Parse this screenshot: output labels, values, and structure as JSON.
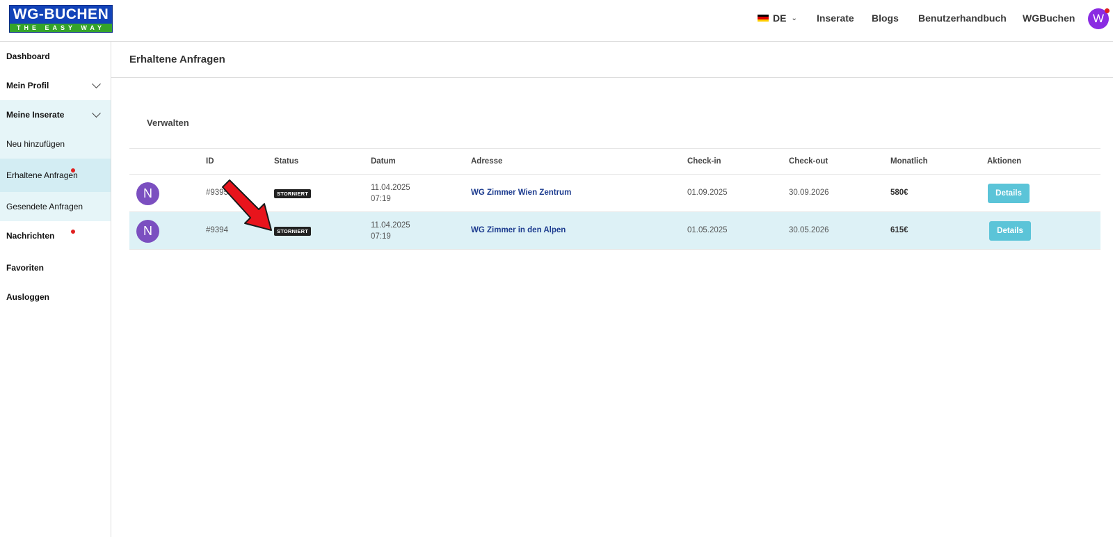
{
  "header": {
    "logo_main": "WG-BUCHEN",
    "logo_tagline": "THE EASY WAY",
    "language": "DE",
    "nav": [
      "Inserate",
      "Blogs",
      "Benutzerhandbuch",
      "WGBuchen"
    ],
    "user_initial": "W"
  },
  "sidebar": {
    "items": [
      {
        "label": "Dashboard"
      },
      {
        "label": "Mein Profil"
      },
      {
        "label": "Meine Inserate"
      },
      {
        "label": "Neu hinzufügen"
      },
      {
        "label": "Erhaltene Anfragen"
      },
      {
        "label": "Gesendete Anfragen"
      },
      {
        "label": "Nachrichten"
      },
      {
        "label": "Favoriten"
      },
      {
        "label": "Ausloggen"
      }
    ]
  },
  "main": {
    "page_title": "Erhaltene Anfragen",
    "section_title": "Verwalten",
    "columns": [
      "ID",
      "Status",
      "Datum",
      "Adresse",
      "Check-in",
      "Check-out",
      "Monatlich",
      "Aktionen"
    ],
    "rows": [
      {
        "initial": "N",
        "id": "#9395",
        "status": "STORNIERT",
        "date": "11.04.2025",
        "time": "07:19",
        "address": "WG Zimmer Wien Zentrum",
        "checkin": "01.09.2025",
        "checkout": "30.09.2026",
        "monthly": "580€",
        "action": "Details"
      },
      {
        "initial": "N",
        "id": "#9394",
        "status": "STORNIERT",
        "date": "11.04.2025",
        "time": "07:19",
        "address": "WG Zimmer in den Alpen",
        "checkin": "01.05.2025",
        "checkout": "30.05.2026",
        "monthly": "615€",
        "action": "Details"
      }
    ]
  },
  "colors": {
    "logo_blue": "#1243b8",
    "logo_green": "#34a32a",
    "avatar_purple": "#8a2be2",
    "row_avatar": "#7b4fc0",
    "sidebar_active_bg": "#e6f5f8",
    "sidebar_selected_bg": "#d3edf3",
    "row_highlight": "#ddf1f6",
    "button": "#5bc4d8",
    "link": "#1d3c8f",
    "notification_dot": "#e02020",
    "annotation_arrow": "#e8141c"
  }
}
